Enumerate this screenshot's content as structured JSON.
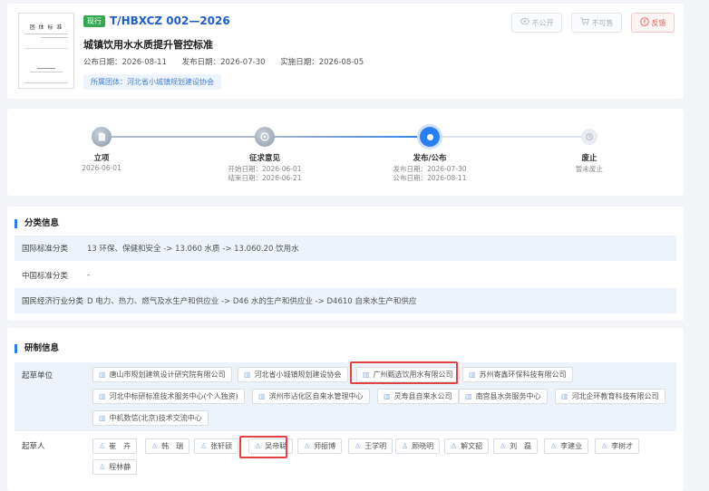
{
  "header": {
    "thumb_title": "团 体 标 准",
    "status_badge": "现行",
    "code": "T/HBXCZ 002—2026",
    "title": "城镇饮用水水质提升管控标准",
    "dates": {
      "announce": "公布日期：2026-08-11",
      "publish": "发布日期：2026-07-30",
      "implement": "实施日期：2026-08-05"
    },
    "org": "所属团体：河北省小城镇规划建设协会",
    "buttons": {
      "public": "不公开",
      "download": "不可售",
      "feedback": "反馈"
    }
  },
  "timeline": {
    "steps": [
      {
        "label": "立项",
        "lines": [
          "2026-06-01"
        ]
      },
      {
        "label": "征求意见",
        "lines": [
          "开始日期：2026-06-01",
          "结束日期：2026-06-21"
        ]
      },
      {
        "label": "发布/公布",
        "lines": [
          "发布日期：2026-07-30",
          "公布日期：2026-08-11"
        ]
      },
      {
        "label": "废止",
        "lines": [
          "暂未废止"
        ]
      }
    ]
  },
  "classification": {
    "title": "分类信息",
    "rows": [
      {
        "key": "国际标准分类",
        "value": "13 环保、保健和安全 -> 13.060 水质 -> 13.060.20 饮用水"
      },
      {
        "key": "中国标准分类",
        "value": "-"
      },
      {
        "key": "国民经济行业分类",
        "value": "D 电力、热力、燃气及水生产和供应业 -> D46 水的生产和供应业 -> D4610 自来水生产和供应"
      }
    ]
  },
  "development": {
    "title": "研制信息",
    "units_label": "起草单位",
    "units": [
      "唐山市规划建筑设计研究院有限公司",
      "河北省小城镇规划建设协会",
      "广州甄选饮用水有限公司",
      "苏州寄鑫环保科技有限公司",
      "河北中标研标准技术服务中心(个人独资)",
      "滨州市沾化区自来水管理中心",
      "灵寿县自来水公司",
      "南宫县水务服务中心",
      "河北企环教育科技有限公司",
      "中机数信(北京)技术交流中心"
    ],
    "people_label": "起草人",
    "people": [
      "崔　卉",
      "韩　瑞",
      "张轩硕",
      "吴帝聪",
      "师振博",
      "王学明",
      "顾晓明",
      "解文韶",
      "刘　磊",
      "李建业",
      "李树才",
      "程林静"
    ]
  }
}
